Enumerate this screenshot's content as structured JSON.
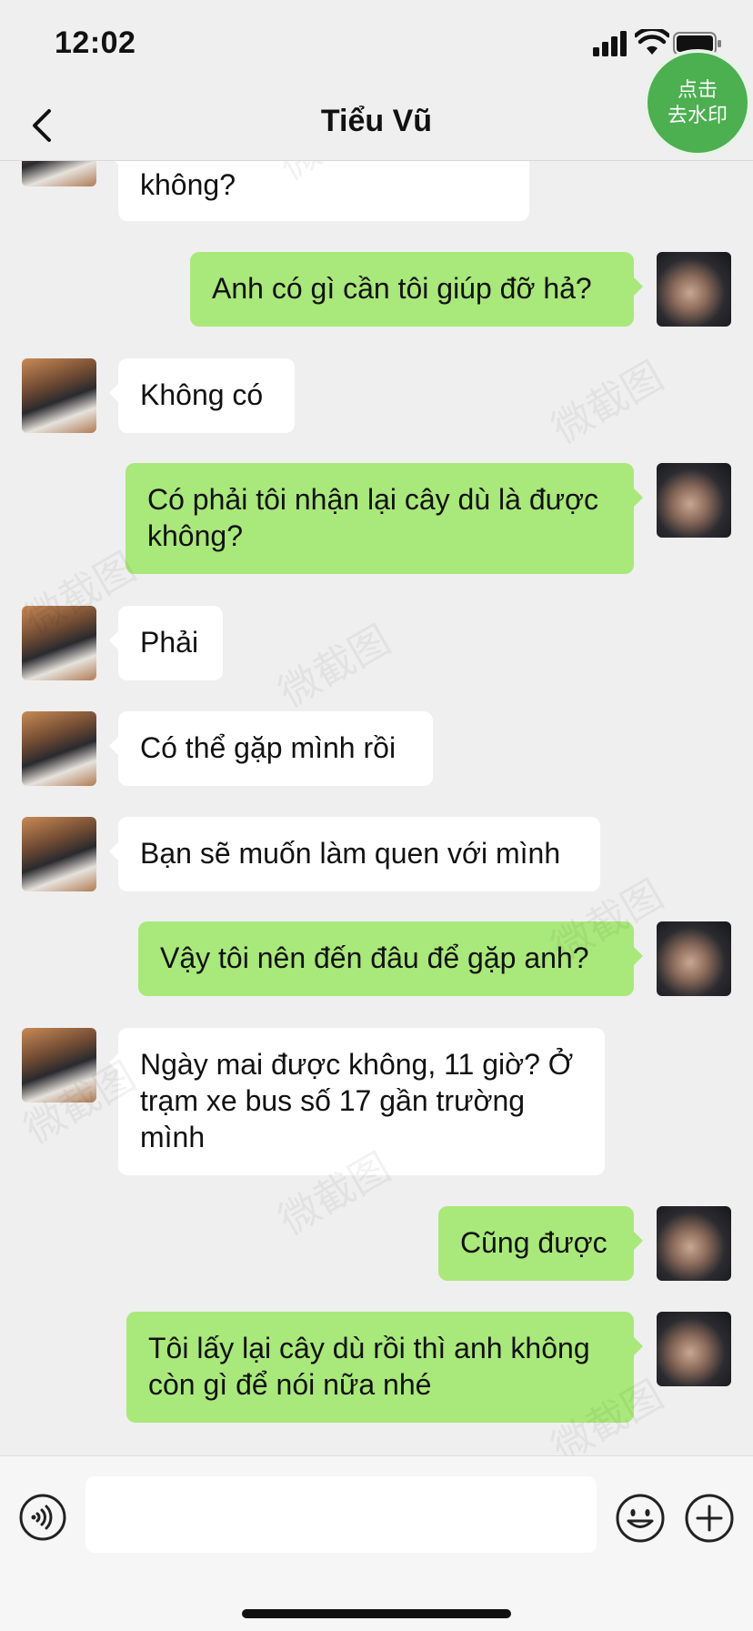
{
  "status": {
    "time": "12:02"
  },
  "header": {
    "title": "Tiểu Vũ"
  },
  "watermark_badge": {
    "label": "点击\n去水印",
    "line1": "点击",
    "line2": "去水印",
    "color": "#4caf50"
  },
  "watermark_text": "微截图",
  "colors": {
    "outgoing_bubble": "#a9e87a",
    "incoming_bubble": "#ffffff",
    "background": "#efefef"
  },
  "messages": [
    {
      "side": "in",
      "text": "không?"
    },
    {
      "side": "out",
      "text": "Anh có gì cần tôi giúp đỡ hả?"
    },
    {
      "side": "in",
      "text": "Không có"
    },
    {
      "side": "out",
      "text": "Có phải tôi nhận lại cây dù là được không?"
    },
    {
      "side": "in",
      "text": "Phải"
    },
    {
      "side": "in",
      "text": "Có thể gặp mình rồi"
    },
    {
      "side": "in",
      "text": "Bạn sẽ muốn làm quen với mình"
    },
    {
      "side": "out",
      "text": "Vậy tôi nên đến đâu để gặp anh?"
    },
    {
      "side": "in",
      "text": "Ngày mai được không, 11 giờ? Ở trạm xe bus số 17 gần trường mình"
    },
    {
      "side": "out",
      "text": "Cũng được"
    },
    {
      "side": "out",
      "text": "Tôi lấy lại cây dù rồi thì anh không còn gì để nói nữa nhé"
    }
  ],
  "input": {
    "value": "",
    "placeholder": ""
  },
  "icons": {
    "back": "chevron-left-icon",
    "voice": "voice-icon",
    "emoji": "emoji-icon",
    "plus": "plus-icon"
  }
}
